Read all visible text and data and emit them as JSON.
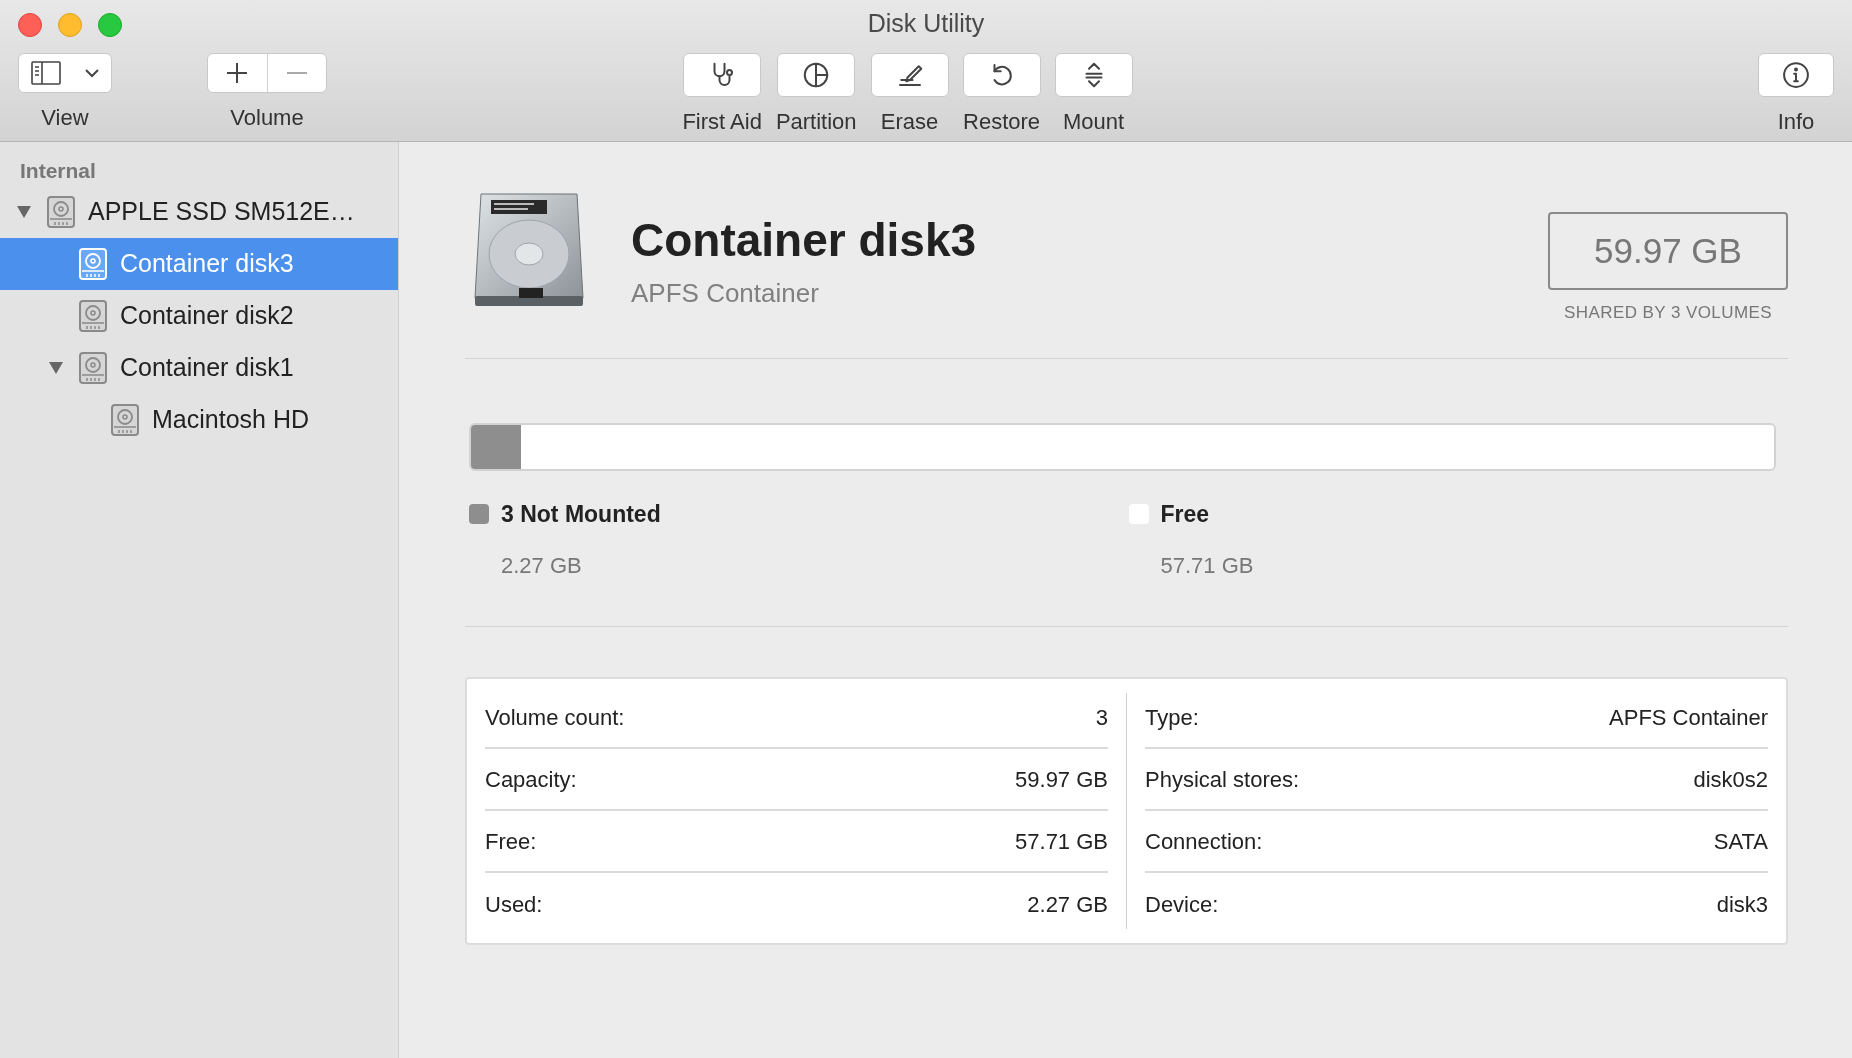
{
  "window": {
    "title": "Disk Utility"
  },
  "toolbar": {
    "left": [
      {
        "kind": "view",
        "label": "View"
      },
      {
        "kind": "volume",
        "label": "Volume"
      }
    ],
    "center": [
      {
        "kind": "first-aid",
        "label": "First Aid"
      },
      {
        "kind": "partition",
        "label": "Partition"
      },
      {
        "kind": "erase",
        "label": "Erase"
      },
      {
        "kind": "restore",
        "label": "Restore"
      },
      {
        "kind": "mount",
        "label": "Mount"
      }
    ],
    "right": [
      {
        "kind": "info",
        "label": "Info"
      }
    ]
  },
  "sidebar": {
    "section": "Internal",
    "items": [
      {
        "label": "APPLE SSD SM512E…",
        "expanded": true,
        "selected": false,
        "children": [
          {
            "label": "Container disk3",
            "selected": true
          },
          {
            "label": "Container disk2",
            "selected": false
          },
          {
            "label": "Container disk1",
            "expanded": true,
            "selected": false,
            "children": [
              {
                "label": "Macintosh HD",
                "selected": false
              }
            ]
          }
        ]
      }
    ]
  },
  "header": {
    "title": "Container disk3",
    "subtitle": "APFS Container",
    "capacity": "59.97 GB",
    "capacity_note": "SHARED BY 3 VOLUMES"
  },
  "usage": {
    "segments": [
      {
        "label": "3 Not Mounted",
        "size": "2.27 GB",
        "color": "#8e8e8e",
        "level": 0.038
      },
      {
        "label": "Free",
        "size": "57.71 GB",
        "color": "#ffffff",
        "level": 0.962
      }
    ]
  },
  "details": {
    "left": [
      {
        "label": "Volume count:",
        "value": "3"
      },
      {
        "label": "Capacity:",
        "value": "59.97 GB"
      },
      {
        "label": "Free:",
        "value": "57.71 GB"
      },
      {
        "label": "Used:",
        "value": "2.27 GB"
      }
    ],
    "right": [
      {
        "label": "Type:",
        "value": "APFS Container"
      },
      {
        "label": "Physical stores:",
        "value": "disk0s2"
      },
      {
        "label": "Connection:",
        "value": "SATA"
      },
      {
        "label": "Device:",
        "value": "disk3"
      }
    ]
  }
}
